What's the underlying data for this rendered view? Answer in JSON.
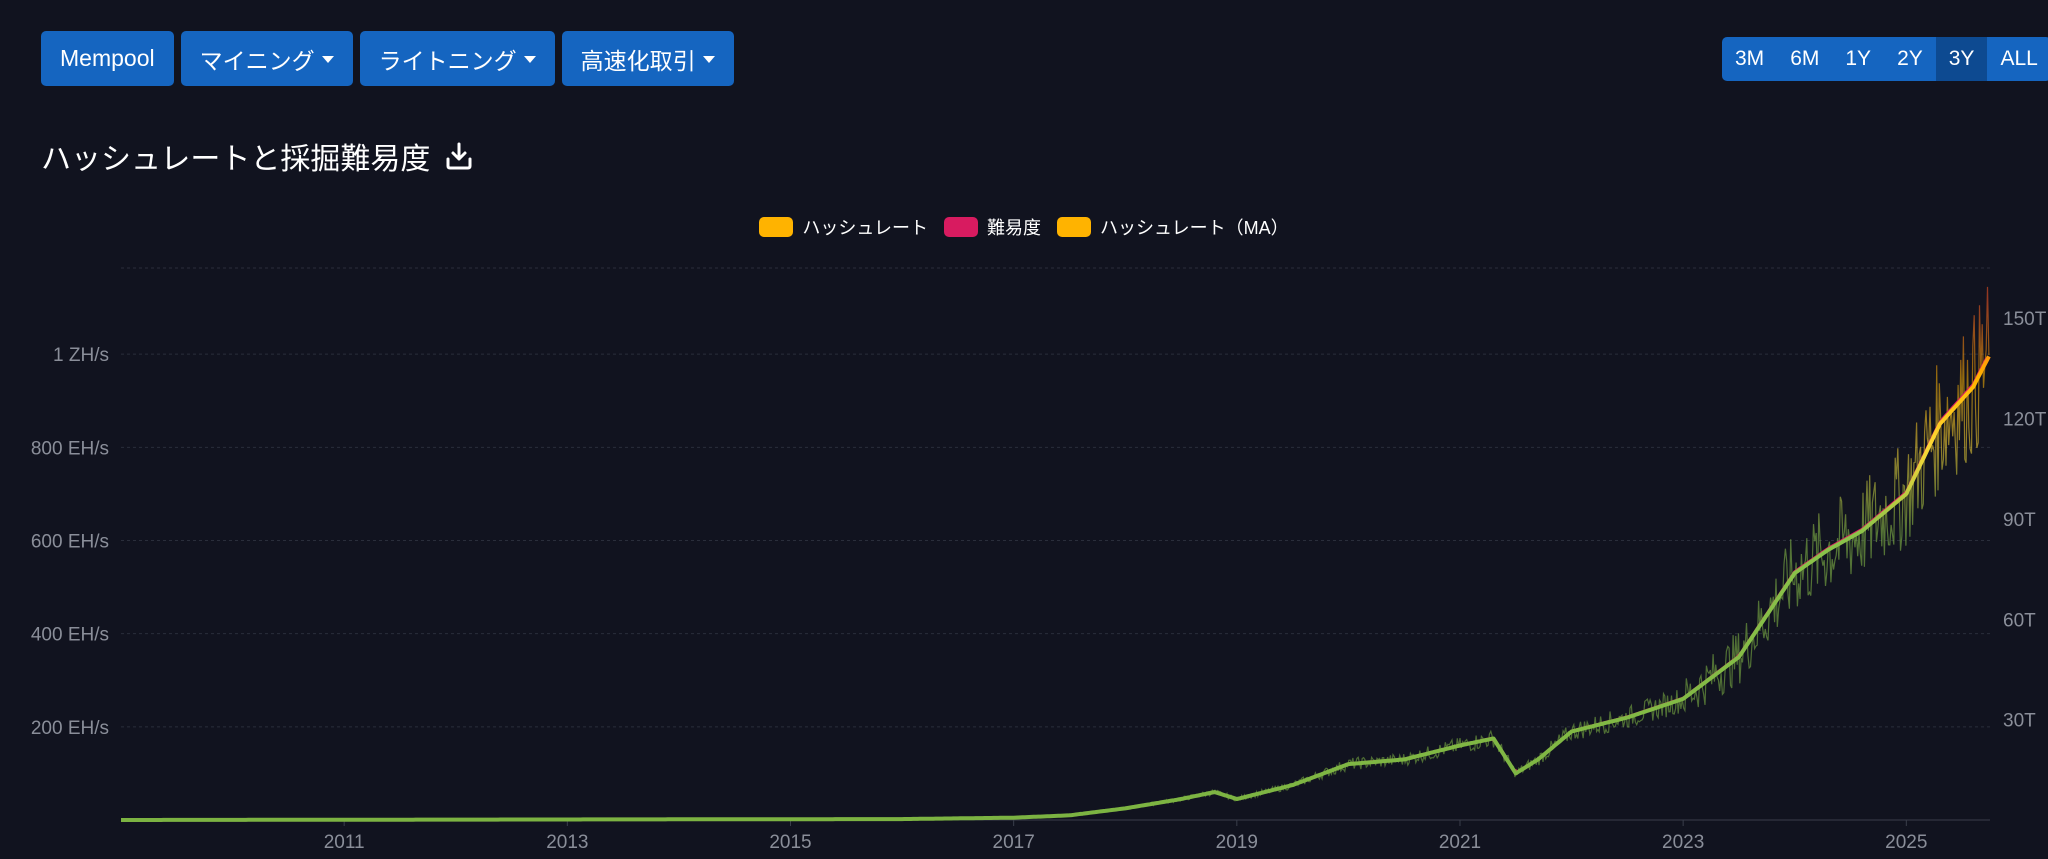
{
  "nav": {
    "items": [
      {
        "label": "Mempool",
        "dropdown": false
      },
      {
        "label": "マイニング",
        "dropdown": true
      },
      {
        "label": "ライトニング",
        "dropdown": true
      },
      {
        "label": "高速化取引",
        "dropdown": true
      }
    ]
  },
  "range": {
    "options": [
      "3M",
      "6M",
      "1Y",
      "2Y",
      "3Y",
      "ALL"
    ],
    "selected": "3Y"
  },
  "page_title": "ハッシュレートと採掘難易度",
  "icons": {
    "download": "download-icon"
  },
  "colors": {
    "background": "#11131f",
    "button": "#1565c0",
    "hashrate": "#ffb300",
    "difficulty": "#d81b60",
    "hashrate_ma": "#ffb300",
    "grid": "#2a2e3b",
    "axis_text": "#8a8e99"
  },
  "chart_data": {
    "type": "line",
    "title": "",
    "legend": [
      {
        "name": "ハッシュレート",
        "color": "#ffb300"
      },
      {
        "name": "難易度",
        "color": "#d81b60"
      },
      {
        "name": "ハッシュレート（MA）",
        "color": "#ffb300"
      }
    ],
    "legend_position": "top-center",
    "grid": true,
    "x_ticks": [
      "2011",
      "2013",
      "2015",
      "2017",
      "2019",
      "2021",
      "2023",
      "2025"
    ],
    "x_range": [
      2009.0,
      2025.75
    ],
    "y_left": {
      "ticks": [
        200,
        400,
        600,
        800,
        1000
      ],
      "tick_labels": [
        "200 EH/s",
        "400 EH/s",
        "600 EH/s",
        "800 EH/s",
        "1 ZH/s"
      ],
      "range": [
        0,
        1185
      ],
      "unit": "EH/s"
    },
    "y_right": {
      "ticks": [
        30,
        60,
        90,
        120,
        150
      ],
      "tick_labels": [
        "30T",
        "60T",
        "90T",
        "120T",
        "150T"
      ],
      "range": [
        0,
        165
      ],
      "unit": "T"
    },
    "series": [
      {
        "name": "ハッシュレート（MA）",
        "axis": "left",
        "x": [
          2009.0,
          2016.0,
          2017.0,
          2017.5,
          2018.0,
          2018.5,
          2018.8,
          2019.0,
          2019.5,
          2020.0,
          2020.5,
          2021.0,
          2021.3,
          2021.5,
          2021.7,
          2022.0,
          2022.5,
          2023.0,
          2023.5,
          2024.0,
          2024.3,
          2024.6,
          2025.0,
          2025.3,
          2025.6,
          2025.75
        ],
        "y": [
          0,
          2,
          5,
          10,
          25,
          45,
          60,
          45,
          75,
          120,
          130,
          160,
          175,
          100,
          130,
          190,
          220,
          260,
          350,
          530,
          580,
          620,
          700,
          850,
          930,
          1000
        ]
      },
      {
        "name": "難易度",
        "axis": "right",
        "x": [
          2009.0,
          2016.0,
          2017.0,
          2017.5,
          2018.0,
          2018.5,
          2018.8,
          2019.0,
          2019.5,
          2020.0,
          2020.5,
          2021.0,
          2021.3,
          2021.5,
          2021.7,
          2022.0,
          2022.5,
          2023.0,
          2023.5,
          2024.0,
          2024.3,
          2024.6,
          2025.0,
          2025.3,
          2025.6,
          2025.75
        ],
        "y": [
          0,
          0.3,
          0.7,
          1.4,
          3.5,
          6.3,
          8.4,
          6.3,
          10.5,
          16.8,
          18.2,
          22.4,
          24.5,
          14.0,
          18.2,
          26.6,
          30.8,
          36.4,
          49.0,
          74.2,
          81.2,
          86.8,
          98.0,
          119.0,
          130.2,
          140.0
        ]
      }
    ]
  }
}
